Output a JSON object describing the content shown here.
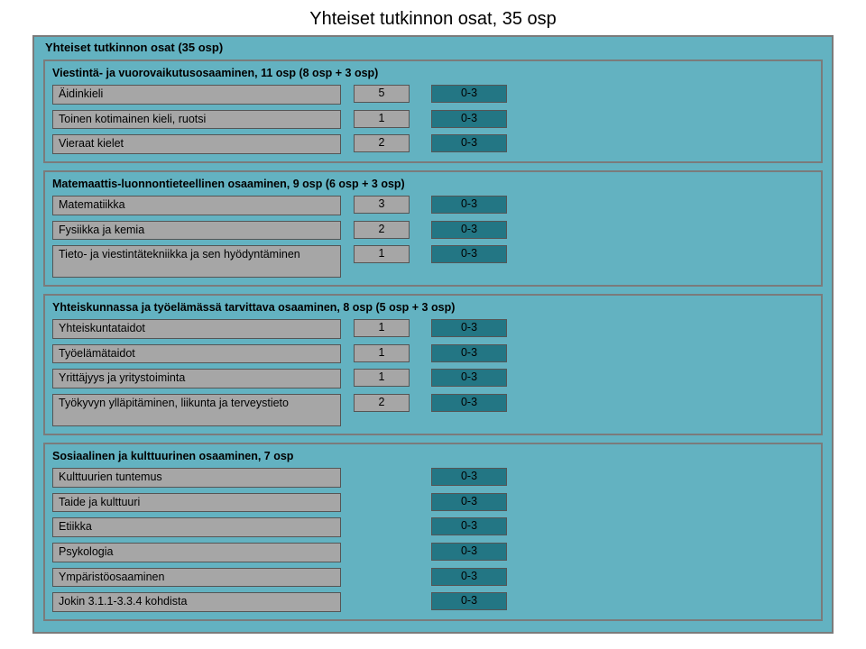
{
  "pageTitle": "Yhteiset tutkinnon osat, 35 osp",
  "outerTitle": "Yhteiset tutkinnon osat (35 osp)",
  "sections": [
    {
      "title": "Viestintä- ja vuorovaikutusosaaminen, 11 osp (8 osp + 3 osp)",
      "rows": [
        {
          "name": "Äidinkieli",
          "value": "5",
          "range": "0-3"
        },
        {
          "name": "Toinen kotimainen kieli, ruotsi",
          "value": "1",
          "range": "0-3"
        },
        {
          "name": "Vieraat kielet",
          "value": "2",
          "range": "0-3"
        }
      ]
    },
    {
      "title": "Matemaattis-luonnontieteellinen osaaminen, 9 osp (6 osp + 3 osp)",
      "rows": [
        {
          "name": "Matematiikka",
          "value": "3",
          "range": "0-3"
        },
        {
          "name": "Fysiikka ja kemia",
          "value": "2",
          "range": "0-3"
        },
        {
          "name": "Tieto- ja viestintätekniikka ja sen hyödyntäminen",
          "value": "1",
          "range": "0-3",
          "tall": true
        }
      ]
    },
    {
      "title": "Yhteiskunnassa ja työelämässä tarvittava osaaminen, 8 osp (5 osp + 3 osp)",
      "rows": [
        {
          "name": "Yhteiskuntataidot",
          "value": "1",
          "range": "0-3"
        },
        {
          "name": "Työelämätaidot",
          "value": "1",
          "range": "0-3"
        },
        {
          "name": "Yrittäjyys ja yritystoiminta",
          "value": "1",
          "range": "0-3"
        },
        {
          "name": "Työkyvyn ylläpitäminen, liikunta ja terveystieto",
          "value": "2",
          "range": "0-3",
          "tall": true
        }
      ]
    },
    {
      "title": "Sosiaalinen ja kulttuurinen osaaminen, 7 osp",
      "rows": [
        {
          "name": "Kulttuurien tuntemus",
          "range": "0-3"
        },
        {
          "name": "Taide ja kulttuuri",
          "range": "0-3"
        },
        {
          "name": "Etiikka",
          "range": "0-3"
        },
        {
          "name": "Psykologia",
          "range": "0-3"
        },
        {
          "name": "Ympäristöosaaminen",
          "range": "0-3"
        },
        {
          "name": "Jokin 3.1.1-3.3.4 kohdista",
          "range": "0-3"
        }
      ]
    }
  ]
}
